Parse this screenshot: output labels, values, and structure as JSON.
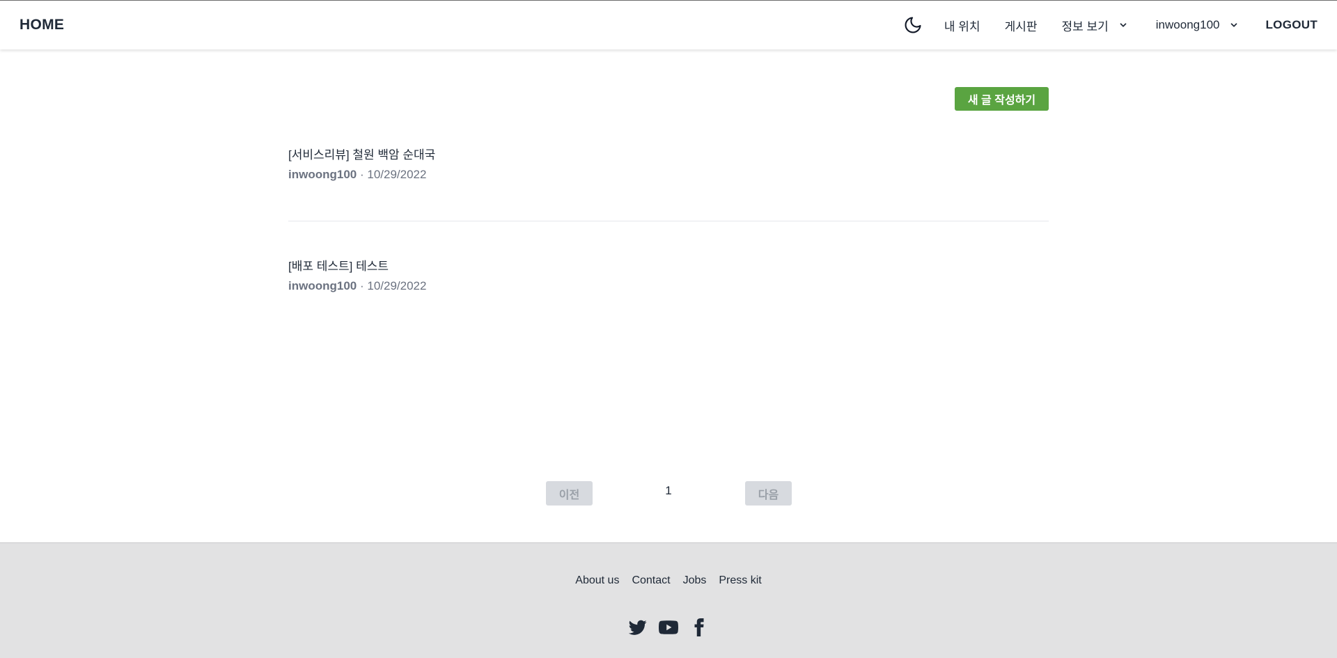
{
  "navbar": {
    "brand": "HOME",
    "my_location": "내 위치",
    "board": "게시판",
    "info_view": "정보 보기",
    "username": "inwoong100",
    "logout": "LOGOUT",
    "icons": {
      "theme": "moon-icon",
      "dropdown": "chevron-down-icon"
    }
  },
  "main": {
    "write_button": "새 글 작성하기",
    "accent_color": "#5aa441",
    "posts": [
      {
        "title": "[서비스리뷰] 철원 백암 순대국",
        "author": "inwoong100",
        "separator": "·",
        "date": "10/29/2022"
      },
      {
        "title": "[배포 테스트] 테스트",
        "author": "inwoong100",
        "separator": "·",
        "date": "10/29/2022"
      }
    ]
  },
  "pagination": {
    "prev": "이전",
    "current": "1",
    "next": "다음"
  },
  "footer": {
    "links": [
      "About us",
      "Contact",
      "Jobs",
      "Press kit"
    ],
    "socials": [
      "twitter-icon",
      "youtube-icon",
      "facebook-icon"
    ]
  }
}
